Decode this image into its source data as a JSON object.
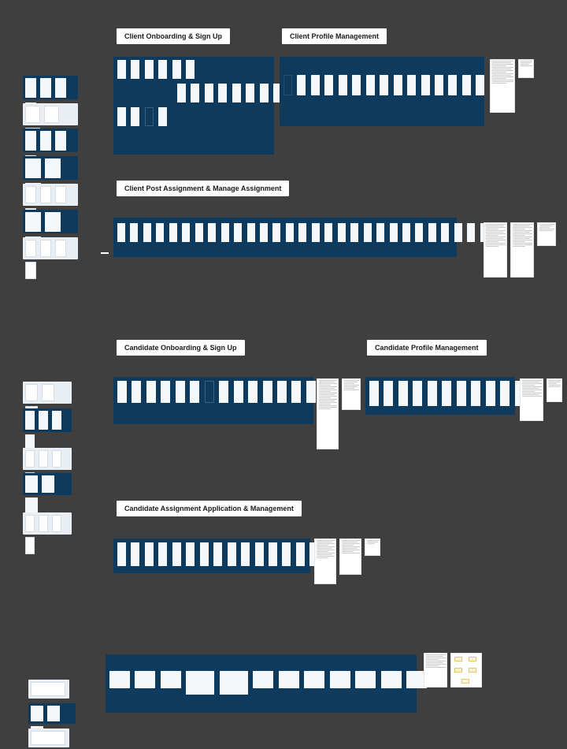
{
  "sections": {
    "client_onboarding": {
      "label": "Client Onboarding & Sign Up"
    },
    "client_profile": {
      "label": "Client Profile Management"
    },
    "client_post_assignment": {
      "label": "Client Post Assignment & Manage Assignment"
    },
    "candidate_onboarding": {
      "label": "Candidate  Onboarding & Sign Up"
    },
    "candidate_profile": {
      "label": "Candidate  Profile Management"
    },
    "candidate_assignment": {
      "label": "Candidate  Assignment Application & Management"
    }
  },
  "colors": {
    "canvas_bg": "#3f3f3f",
    "board_bg": "#0e3a5e",
    "screen_bg": "#f5f8fa",
    "label_bg": "#ffffff"
  }
}
